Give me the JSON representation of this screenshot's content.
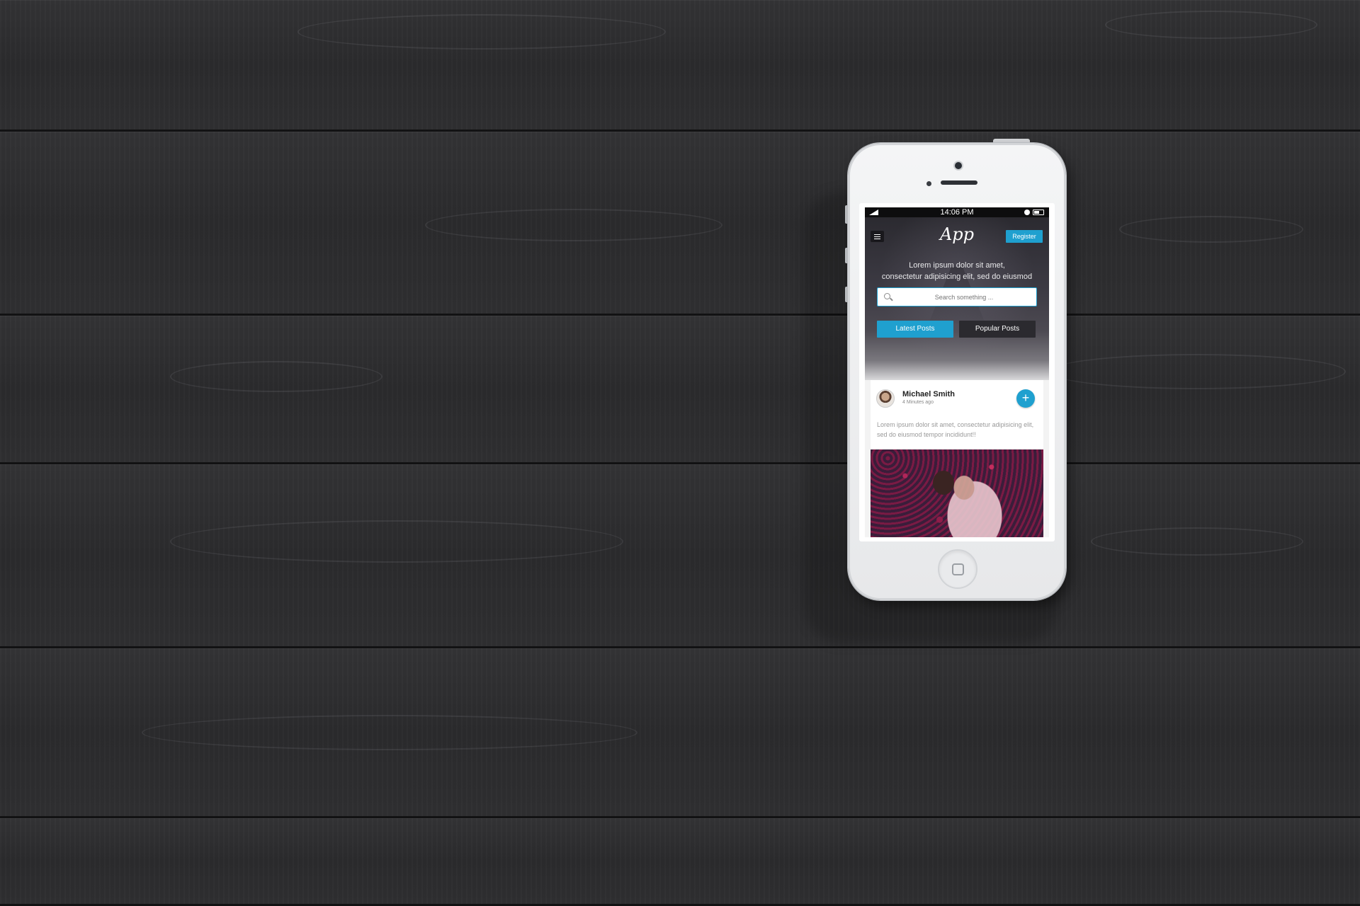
{
  "phone": {
    "status_bar": {
      "time": "14:06 PM"
    },
    "header": {
      "logo": "App",
      "register_label": "Register"
    },
    "hero": {
      "tagline_line1": "Lorem ipsum dolor sit amet,",
      "tagline_line2": "consectetur adipisicing elit, sed do eiusmod"
    },
    "search": {
      "placeholder": "Search something ..."
    },
    "tabs": [
      {
        "label": "Latest Posts",
        "active": true
      },
      {
        "label": "Popular Posts",
        "active": false
      }
    ],
    "post": {
      "author": "Michael Smith",
      "time_ago": "4 Minutes ago",
      "excerpt": "Lorem ipsum dolor sit amet, consectetur adipisicing elit, sed do eiusmod tempor incididunt!!",
      "follow_icon": "plus-icon"
    }
  },
  "colors": {
    "accent": "#1fa0cf",
    "background": "#2a2a2b"
  }
}
